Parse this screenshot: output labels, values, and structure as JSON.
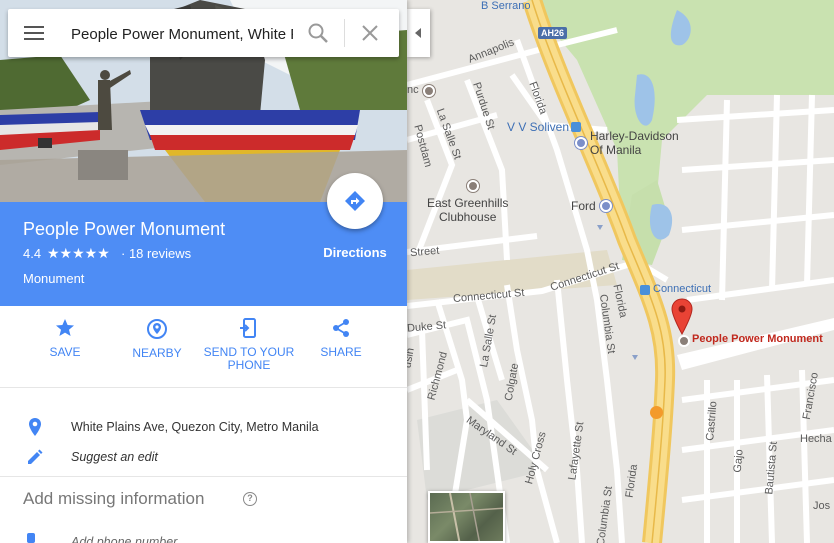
{
  "search": {
    "value": "People Power Monument, White Plains Ave"
  },
  "place": {
    "title": "People Power Monument",
    "rating": "4.4",
    "stars": "★★★★★",
    "reviews": "· 18 reviews",
    "type": "Monument",
    "directions_label": "Directions"
  },
  "actions": [
    {
      "label": "SAVE",
      "icon": "star-icon"
    },
    {
      "label": "NEARBY",
      "icon": "nearby-icon"
    },
    {
      "label": "SEND TO YOUR PHONE",
      "icon": "send-to-phone-icon"
    },
    {
      "label": "SHARE",
      "icon": "share-icon"
    }
  ],
  "info": {
    "address": "White Plains Ave, Quezon City, Metro Manila",
    "suggest_edit": "Suggest an edit",
    "add_missing": "Add missing information",
    "add_phone": "Add phone number"
  },
  "map": {
    "labels": {
      "b_serrano": "B Serrano",
      "ah26": "AH26",
      "annapolis": "Annapolis",
      "purdue": "Purdue St",
      "la_salle_top": "La Salle St",
      "florida_top": "Florida",
      "postdam": "Postdam",
      "vv_soliven": "V V Soliven",
      "harley": "Harley-Davidson\nOf Manila",
      "greenhills": "East Greenhills\nClubhouse",
      "ford": "Ford",
      "street": "Street",
      "connecticut_st_1": "Connecticut St",
      "connecticut_st_2": "Connecticut St",
      "connecticut_station": "Connecticut",
      "florida_mid": "Florida",
      "columbia_mid": "Columbia St",
      "duke": "Duke St",
      "la_salle_mid": "La Salle St",
      "colgate": "Colgate",
      "richmond": "Richmond",
      "maryland": "Maryland St",
      "holy_cross": "Holy Cross",
      "lafayette": "Lafayette St",
      "columbia_bottom": "Columbia St",
      "florida_bottom": "Florida",
      "castrillo": "Castrillo",
      "gajo": "Gajo",
      "bautista": "Bautista St",
      "francisco": "Francisco",
      "hecha": "Hecha",
      "marker": "People Power Monument",
      "c_edge": "nc",
      "jos": "Jos",
      "usin": "usin"
    }
  }
}
